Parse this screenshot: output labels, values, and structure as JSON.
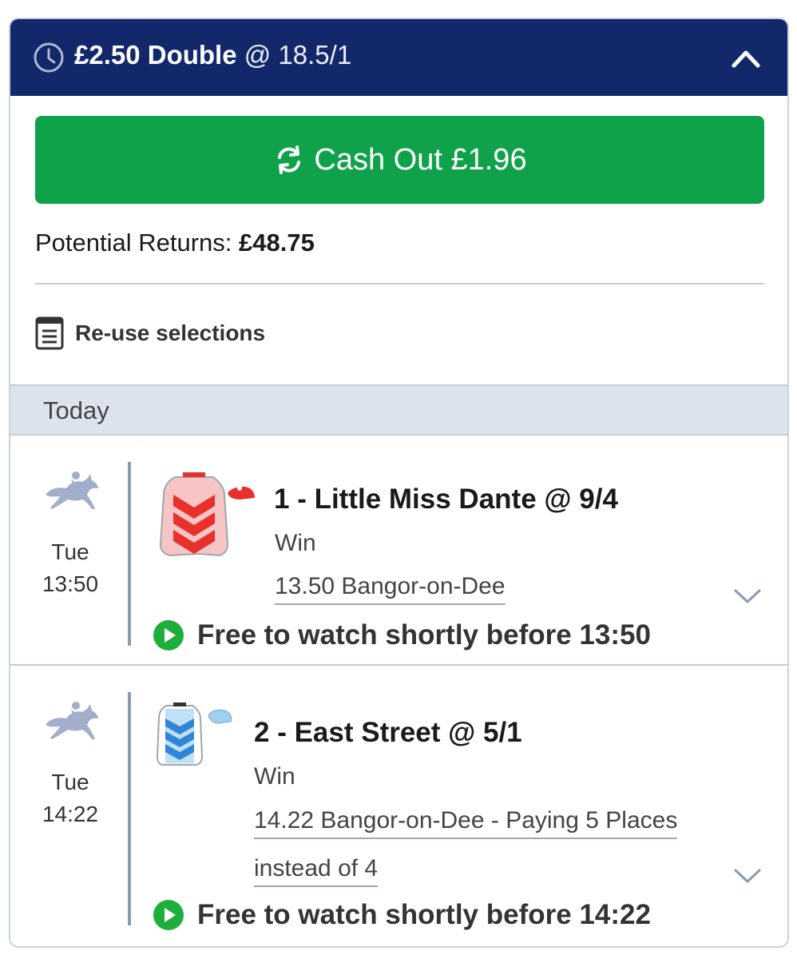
{
  "header": {
    "stake": "£2.50 Double",
    "odds": "@ 18.5/1",
    "icon": "clock-icon",
    "collapse_icon": "chevron-up-icon",
    "bg_color": "#13286b"
  },
  "cashout": {
    "label": "Cash Out £1.96",
    "icon": "cashout-arrows-icon",
    "color": "#10a24a"
  },
  "returns": {
    "label": "Potential Returns:",
    "value": "£48.75"
  },
  "reuse": {
    "label": "Re-use selections",
    "icon": "document-list-icon"
  },
  "day_header": "Today",
  "selections": [
    {
      "day": "Tue",
      "time": "13:50",
      "title": "1 - Little Miss Dante @ 9/4",
      "market": "Win",
      "event_line1": "13.50 Bangor-on-Dee",
      "event_line2": "",
      "watch": "Free to watch shortly before 13:50",
      "silk_color": "#e8302c"
    },
    {
      "day": "Tue",
      "time": "14:22",
      "title": "2 - East Street @ 5/1",
      "market": "Win",
      "event_line1": "14.22 Bangor-on-Dee - Paying 5 Places",
      "event_line2": "instead of 4",
      "watch": "Free to watch shortly before 14:22",
      "silk_color": "#2f86d6"
    }
  ]
}
